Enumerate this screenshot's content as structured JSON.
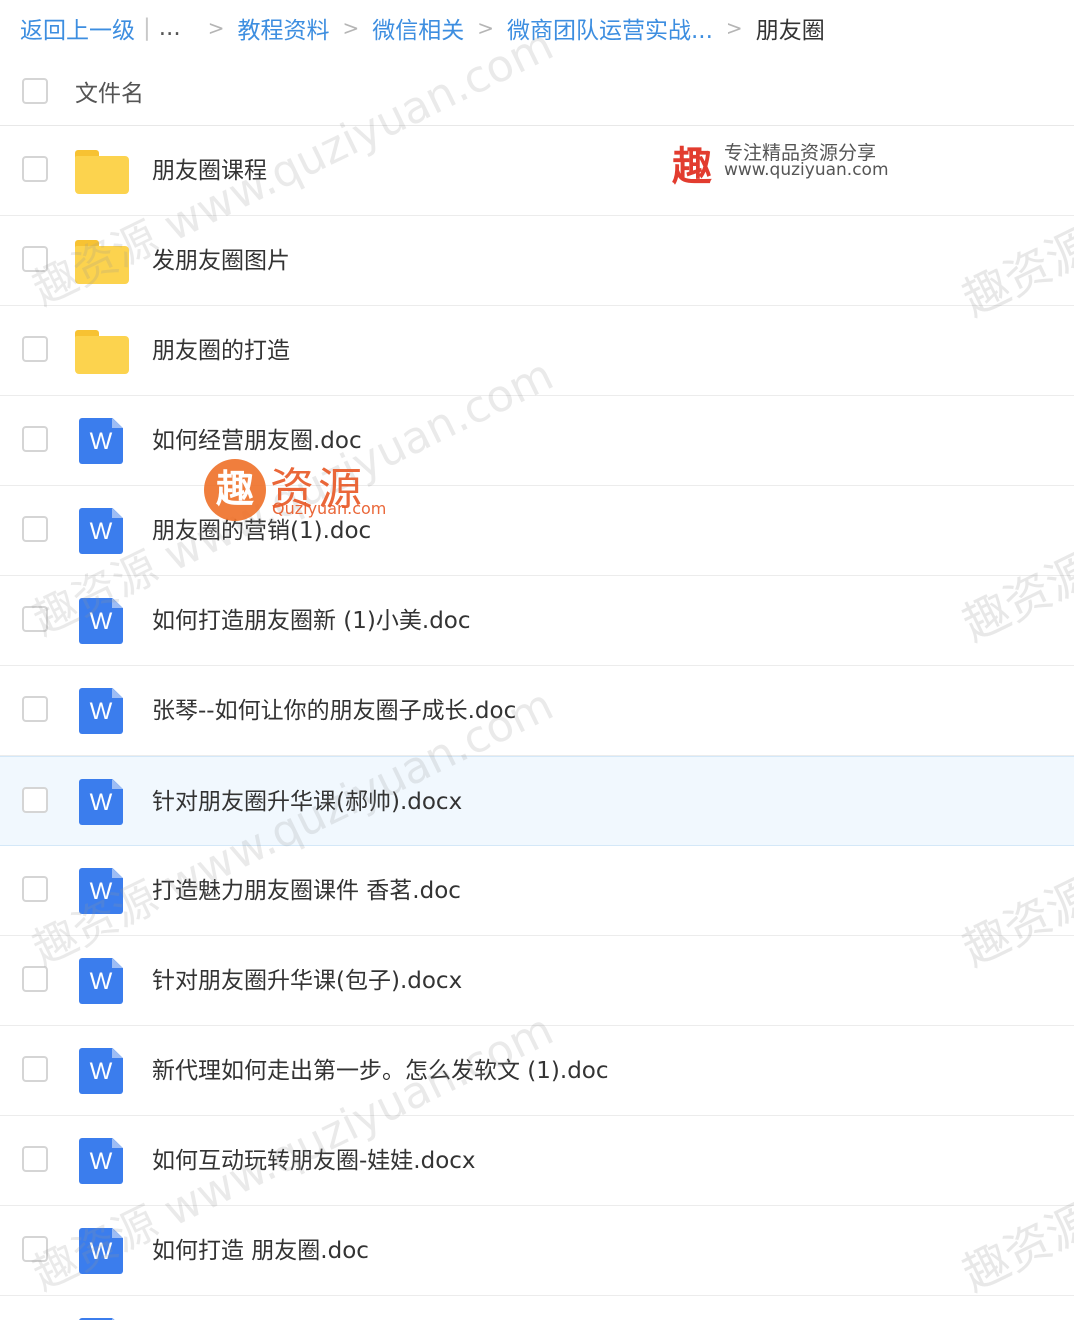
{
  "breadcrumb": {
    "back": "返回上一级",
    "pipe": "|",
    "ellipsis": "...",
    "separator": ">",
    "items": [
      "教程资料",
      "微信相关",
      "微商团队运营实战...",
      "朋友圈"
    ]
  },
  "header": {
    "column_label": "文件名"
  },
  "files": [
    {
      "name": "朋友圈课程",
      "type": "folder"
    },
    {
      "name": "发朋友圈图片",
      "type": "folder"
    },
    {
      "name": "朋友圈的打造",
      "type": "folder"
    },
    {
      "name": "如何经营朋友圈.doc",
      "type": "word-doc"
    },
    {
      "name": "朋友圈的营销(1).doc",
      "type": "word-doc"
    },
    {
      "name": "如何打造朋友圈新 (1)小美.doc",
      "type": "word-doc"
    },
    {
      "name": "张琴--如何让你的朋友圈子成长.doc",
      "type": "word-doc"
    },
    {
      "name": "针对朋友圈升华课(郝帅).docx",
      "type": "word-doc",
      "highlighted": true
    },
    {
      "name": "打造魅力朋友圈课件 香茗.doc",
      "type": "word-doc"
    },
    {
      "name": "针对朋友圈升华课(包子).docx",
      "type": "word-doc"
    },
    {
      "name": "新代理如何走出第一步。怎么发软文 (1).doc",
      "type": "word-doc"
    },
    {
      "name": "如何互动玩转朋友圈-娃娃.docx",
      "type": "word-doc"
    },
    {
      "name": "如何打造 朋友圈.doc",
      "type": "word-doc"
    }
  ],
  "icons": {
    "word_letter": "W"
  },
  "watermarks": {
    "diagonal": "趣资源 www.quziyuan.com",
    "side": "趣资源",
    "badge_char": "趣",
    "badge_slogan": "专注精品资源分享",
    "badge_site": "www.quziyuan.com",
    "logo_char": "趣",
    "logo_name": "资源",
    "logo_site": "Quziyuan.com"
  },
  "colors": {
    "link": "#3d8ee0",
    "folder": "#fcd34e",
    "word_icon": "#3b7ded",
    "highlight_row": "#f1f8fe",
    "brand_red": "#e23c2f"
  }
}
